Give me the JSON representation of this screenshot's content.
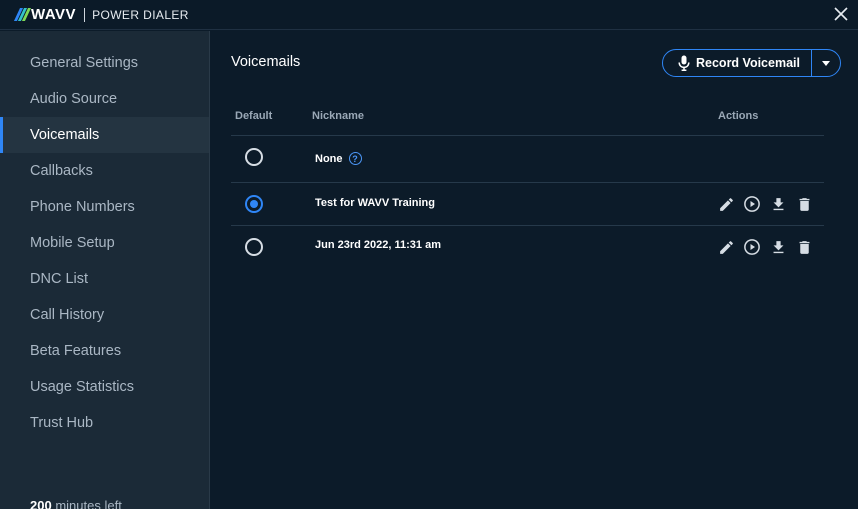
{
  "header": {
    "logo_text": "WAVV",
    "product": "POWER DIALER",
    "stripe_colors": [
      "#2f86f6",
      "#34c3c9",
      "#7ed957"
    ]
  },
  "sidebar": {
    "items": [
      {
        "label": "General Settings",
        "active": false
      },
      {
        "label": "Audio Source",
        "active": false
      },
      {
        "label": "Voicemails",
        "active": true
      },
      {
        "label": "Callbacks",
        "active": false
      },
      {
        "label": "Phone Numbers",
        "active": false
      },
      {
        "label": "Mobile Setup",
        "active": false
      },
      {
        "label": "DNC List",
        "active": false
      },
      {
        "label": "Call History",
        "active": false
      },
      {
        "label": "Beta Features",
        "active": false
      },
      {
        "label": "Usage Statistics",
        "active": false
      },
      {
        "label": "Trust Hub",
        "active": false
      }
    ],
    "minutes_value": "200",
    "minutes_label": "minutes left"
  },
  "main": {
    "title": "Voicemails",
    "record_button": "Record Voicemail",
    "columns": {
      "default": "Default",
      "nickname": "Nickname",
      "actions": "Actions"
    },
    "rows": [
      {
        "nickname": "None",
        "selected": false,
        "help": true,
        "actions": false
      },
      {
        "nickname": "Test for WAVV Training",
        "selected": true,
        "help": false,
        "actions": true
      },
      {
        "nickname": "Jun 23rd 2022, 11:31 am",
        "selected": false,
        "help": false,
        "actions": true
      }
    ],
    "help_glyph": "?"
  },
  "colors": {
    "accent": "#2f86f6",
    "background": "#0c1b29",
    "sidebar": "#1b2a37"
  }
}
